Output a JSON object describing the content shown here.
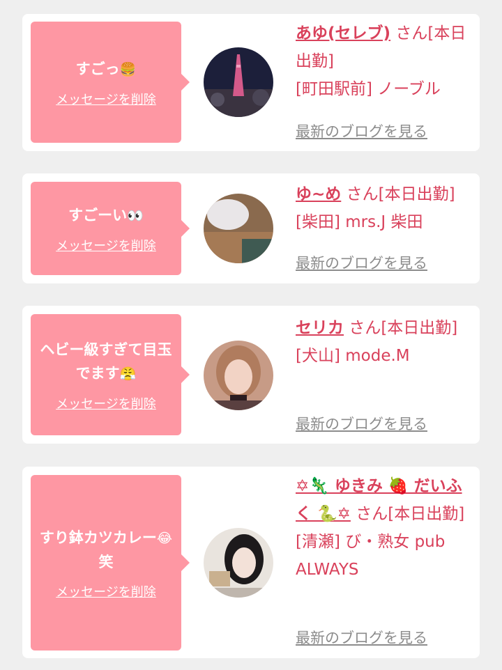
{
  "items": [
    {
      "message": "すごっ",
      "message_emoji": "🍔",
      "delete_label": "メッセージを削除",
      "name": "あゆ(セレブ)",
      "san_status": "さん[本日出勤]",
      "shop": "[町田駅前] ノーブル",
      "blog_label": "最新のブログを見る"
    },
    {
      "message": "すごーい",
      "message_emoji": "👀",
      "delete_label": "メッセージを削除",
      "name": "ゆ~め",
      "san_status": "さん[本日出勤]",
      "shop": "[柴田] mrs.J 柴田",
      "blog_label": "最新のブログを見る"
    },
    {
      "message": "ヘビー級すぎて目玉でます",
      "message_emoji": "😤",
      "delete_label": "メッセージを削除",
      "name": "セリカ",
      "san_status": "さん[本日出勤]",
      "shop": "[犬山] mode.M",
      "blog_label": "最新のブログを見る"
    },
    {
      "message": "すり鉢カツカレー",
      "message_emoji": "😂",
      "message_tail": "笑",
      "delete_label": "メッセージを削除",
      "name": "✡🦎 ゆきみ 🍓 だいふく 🐍✡",
      "san_status": "さん[本日出勤]",
      "shop": "[清瀬] び・熟女 pub ALWAYS",
      "blog_label": "最新のブログを見る"
    }
  ],
  "colors": {
    "accent": "#fe97a3",
    "name": "#d9415b",
    "muted": "#8c8c8c"
  }
}
